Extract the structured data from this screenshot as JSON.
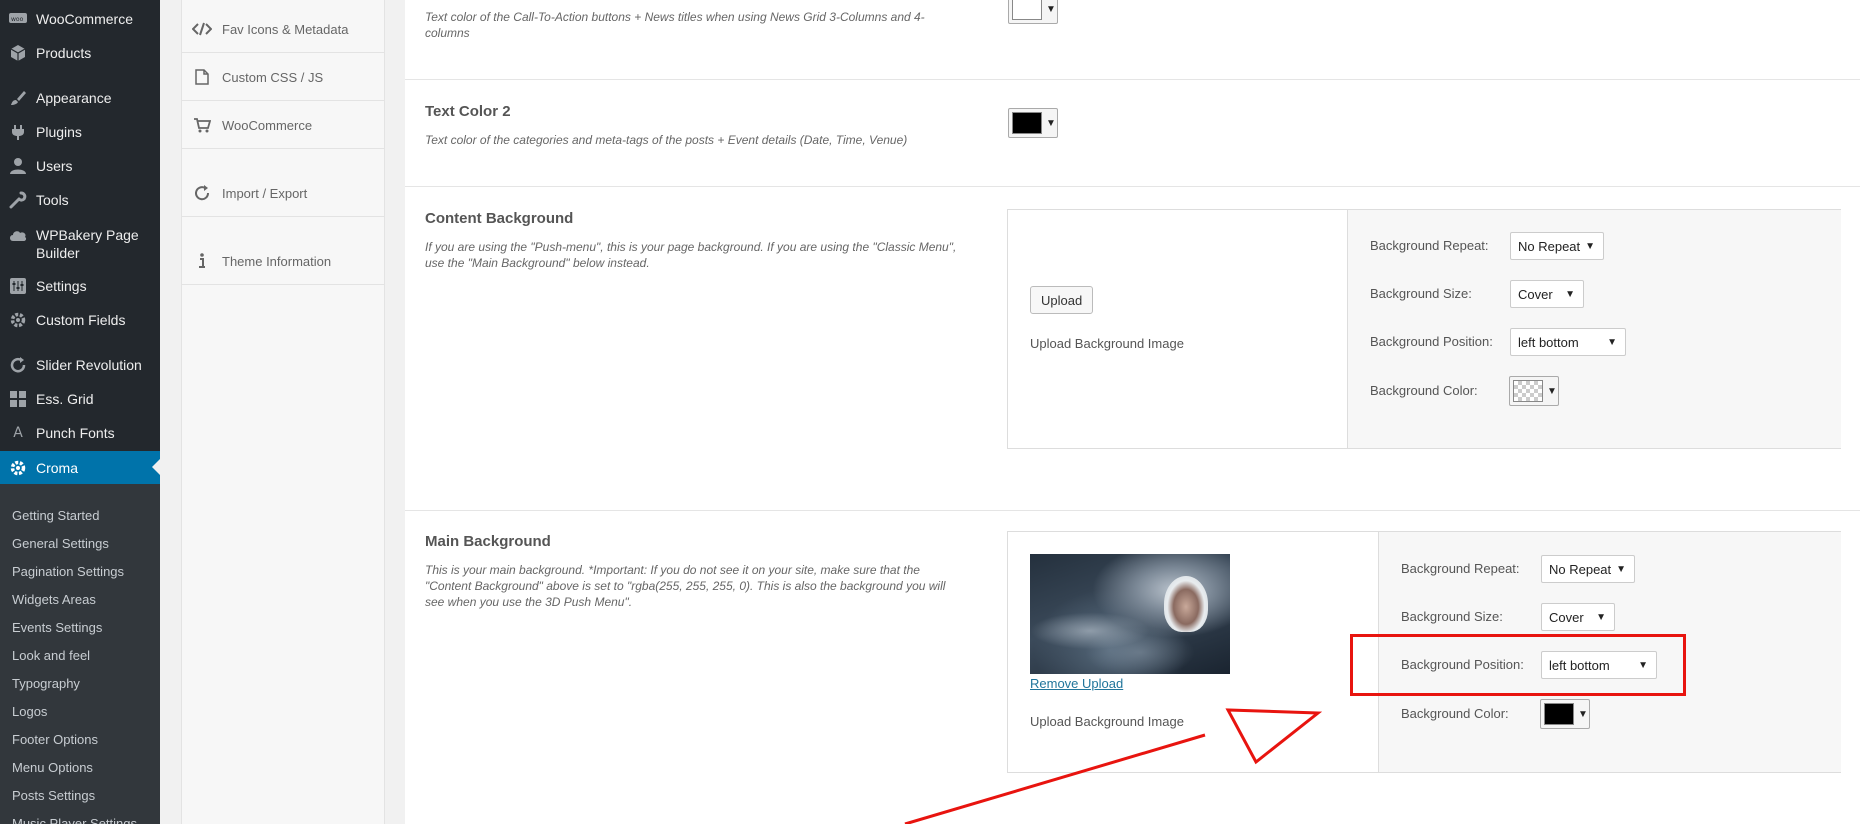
{
  "admin_menu": {
    "items": [
      {
        "label": "WooCommerce",
        "icon": "woo-icon"
      },
      {
        "label": "Products",
        "icon": "products-cube-icon"
      },
      {
        "label": "Appearance",
        "icon": "paintbrush-icon"
      },
      {
        "label": "Plugins",
        "icon": "plug-icon"
      },
      {
        "label": "Users",
        "icon": "user-icon"
      },
      {
        "label": "Tools",
        "icon": "wrench-icon"
      },
      {
        "label": "WPBakery Page Builder",
        "icon": "cloud-icon"
      },
      {
        "label": "Settings",
        "icon": "settings-sliders-icon"
      },
      {
        "label": "Custom Fields",
        "icon": "gear-icon"
      },
      {
        "label": "Slider Revolution",
        "icon": "refresh-icon"
      },
      {
        "label": "Ess. Grid",
        "icon": "grid-icon"
      },
      {
        "label": "Punch Fonts",
        "icon": "letter-a-icon"
      },
      {
        "label": "Croma",
        "icon": "gear-icon"
      }
    ],
    "submenu": [
      "Getting Started",
      "General Settings",
      "Pagination Settings",
      "Widgets Areas",
      "Events Settings",
      "Look and feel",
      "Typography",
      "Logos",
      "Footer Options",
      "Menu Options",
      "Posts Settings",
      "Music Player Settings"
    ]
  },
  "options_nav": {
    "items": [
      {
        "label": "Fav Icons & Metadata",
        "icon": "code-icon"
      },
      {
        "label": "Custom CSS / JS",
        "icon": "file-icon"
      },
      {
        "label": "WooCommerce",
        "icon": "cart-icon"
      },
      {
        "label": "Import / Export",
        "icon": "refresh-icon"
      },
      {
        "label": "Theme Information",
        "icon": "info-icon"
      }
    ]
  },
  "sections": {
    "text_color_1": {
      "desc": "Text color of the Call-To-Action buttons + News titles when using News Grid 3-Columns and 4-columns",
      "color": "#ffffff"
    },
    "text_color_2": {
      "title": "Text Color 2",
      "desc": "Text color of the categories and meta-tags of the posts + Event details (Date, Time, Venue)",
      "color": "#000000"
    },
    "content_background": {
      "title": "Content Background",
      "desc": "If you are using the \"Push-menu\", this is your page background. If you are using the \"Classic Menu\", use the \"Main Background\" below instead.",
      "upload_button": "Upload",
      "upload_text": "Upload Background Image",
      "repeat_label": "Background Repeat:",
      "repeat_value": "No Repeat",
      "size_label": "Background Size:",
      "size_value": "Cover",
      "position_label": "Background Position:",
      "position_value": "left bottom",
      "color_label": "Background Color:",
      "color": "transparent"
    },
    "main_background": {
      "title": "Main Background",
      "desc": "This is your main background. *Important: If you do not see it on your site, make sure that the \"Content Background\" above is set to \"rgba(255, 255, 255, 0). This is also the background you will see when you use the 3D Push Menu\".",
      "remove_link": "Remove Upload",
      "upload_text": "Upload Background Image",
      "repeat_label": "Background Repeat:",
      "repeat_value": "No Repeat",
      "size_label": "Background Size:",
      "size_value": "Cover",
      "position_label": "Background Position:",
      "position_value": "left bottom",
      "color_label": "Background Color:",
      "color": "#000000"
    }
  },
  "annotation_color": "#e8140f"
}
